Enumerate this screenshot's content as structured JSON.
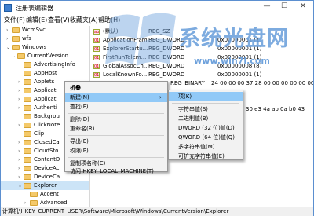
{
  "window": {
    "title": "注册表编辑器",
    "controls": {
      "minimize": "—",
      "maximize": "☐",
      "close": "✕"
    }
  },
  "menubar": {
    "items": [
      {
        "label": "文件(F)"
      },
      {
        "label": "编辑(E)"
      },
      {
        "label": "查看(V)"
      },
      {
        "label": "收藏夹(A)"
      },
      {
        "label": "帮助(H)"
      }
    ]
  },
  "tree": {
    "items": [
      {
        "label": "WcmSvc",
        "arrow": "›"
      },
      {
        "label": "wfs",
        "arrow": "›"
      },
      {
        "label": "Windows",
        "arrow": "⌄"
      },
      {
        "label": "CurrentVersion",
        "arrow": "⌄"
      },
      {
        "label": "AdvertisingInfo",
        "arrow": ""
      },
      {
        "label": "AppHost",
        "arrow": ""
      },
      {
        "label": "Applets",
        "arrow": "›"
      },
      {
        "label": "Applicati",
        "arrow": "›"
      },
      {
        "label": "Applicati",
        "arrow": "›"
      },
      {
        "label": "Authenti",
        "arrow": "›"
      },
      {
        "label": "Backgrou",
        "arrow": ""
      },
      {
        "label": "ClickNote",
        "arrow": "›"
      },
      {
        "label": "Clip",
        "arrow": ""
      },
      {
        "label": "ClosedCa",
        "arrow": "›"
      },
      {
        "label": "CloudSto",
        "arrow": "›"
      },
      {
        "label": "ContentD",
        "arrow": "›"
      },
      {
        "label": "DeviceAc",
        "arrow": "›"
      },
      {
        "label": "DeviceCa",
        "arrow": "›"
      },
      {
        "label": "Explorer",
        "arrow": "⌄"
      },
      {
        "label": "Accent",
        "arrow": ""
      },
      {
        "label": "Advanced",
        "arrow": "›"
      }
    ]
  },
  "list": {
    "rows": [
      {
        "name": "(默认)",
        "type": "REG_SZ",
        "data": ""
      },
      {
        "name": "ApplicationFram...",
        "type": "REG_DWORD",
        "data": "0x00000001 (1)"
      },
      {
        "name": "ExplorerStartu...",
        "type": "REG_DWORD",
        "data": "0x00000001 (1)"
      },
      {
        "name": "FirstRunTelem...",
        "type": "REG_DWORD",
        "data": "0x00000001 (1)"
      },
      {
        "name": "GlobalAssocCh...",
        "type": "REG_DWORD",
        "data": "0x00000008 (8)"
      },
      {
        "name": "LocalKnownFo...",
        "type": "REG_DWORD",
        "data": "0x00000001 (1)"
      }
    ],
    "partial_row": {
      "type": "REG_BINARY",
      "data": "24 00 00 00 37 28 00 00 00 00 00 00 00 00"
    },
    "partial_tail": "30 e3 4a ab 0a b0 43"
  },
  "context_menu": {
    "items": [
      {
        "label": "折叠",
        "bold": true
      },
      {
        "label": "新建(N)",
        "highlighted": true,
        "submenu": true
      },
      {
        "label": "查找(F)..."
      },
      {
        "label": "删除(D)"
      },
      {
        "label": "重命名(R)"
      },
      {
        "label": "导出(E)"
      },
      {
        "label": "权限(P)..."
      },
      {
        "label": "复制项名称(C)"
      },
      {
        "label": "访问 HKEY_LOCAL_MACHINE(T)"
      }
    ]
  },
  "submenu": {
    "items": [
      {
        "label": "项(K)"
      },
      {
        "label": "字符串值(S)"
      },
      {
        "label": "二进制值(B)"
      },
      {
        "label": "DWORD (32 位)值(D)"
      },
      {
        "label": "QWORD (64 位)值(Q)"
      },
      {
        "label": "多字符串值(M)"
      },
      {
        "label": "可扩充字符串值(E)"
      }
    ]
  },
  "statusbar": {
    "path": "计算机\\HKEY_CURRENT_USER\\Software\\Microsoft\\Windows\\CurrentVersion\\Explorer"
  },
  "watermark": {
    "title": "系统光盘网",
    "url": "www.win7l.com",
    "logo_letter": "W"
  },
  "colors": {
    "accent": "#5b8fd0",
    "selection": "#cce4f7",
    "menu_highlight": "#91c9f7",
    "watermark": "#6fa2dc"
  }
}
